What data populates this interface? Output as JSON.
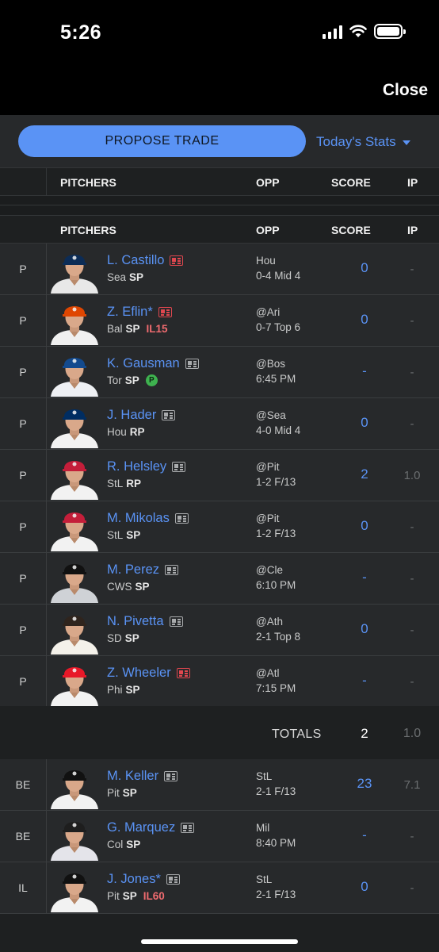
{
  "status_bar": {
    "time": "5:26"
  },
  "nav": {
    "close_label": "Close"
  },
  "actions": {
    "propose_trade_label": "PROPOSE TRADE",
    "stats_view_label": "Today's Stats"
  },
  "columns": {
    "pitchers": "PITCHERS",
    "opp": "OPP",
    "score": "SCORE",
    "ip": "IP"
  },
  "players": [
    {
      "pos": "P",
      "name": "L. Castillo",
      "news_hot": true,
      "team": "Sea",
      "slot": "SP",
      "injury": "",
      "badge": "",
      "opp": "Hou",
      "game": "0-4 Mid 4",
      "score": "0",
      "ip": "-",
      "cap_color": "#0c2c56",
      "jersey_color": "#e8e8e8"
    },
    {
      "pos": "P",
      "name": "Z. Eflin*",
      "news_hot": true,
      "team": "Bal",
      "slot": "SP",
      "injury": "IL15",
      "badge": "",
      "opp": "@Ari",
      "game": "0-7 Top 6",
      "score": "0",
      "ip": "-",
      "cap_color": "#df4601",
      "jersey_color": "#f0f0f0"
    },
    {
      "pos": "P",
      "name": "K. Gausman",
      "news_hot": false,
      "team": "Tor",
      "slot": "SP",
      "injury": "",
      "badge": "P",
      "opp": "@Bos",
      "game": "6:45 PM",
      "score": "-",
      "ip": "-",
      "cap_color": "#134a8e",
      "jersey_color": "#eef0f4"
    },
    {
      "pos": "P",
      "name": "J. Hader",
      "news_hot": false,
      "team": "Hou",
      "slot": "RP",
      "injury": "",
      "badge": "",
      "opp": "@Sea",
      "game": "4-0 Mid 4",
      "score": "0",
      "ip": "-",
      "cap_color": "#002d62",
      "jersey_color": "#f2f2f2"
    },
    {
      "pos": "P",
      "name": "R. Helsley",
      "news_hot": false,
      "team": "StL",
      "slot": "RP",
      "injury": "",
      "badge": "",
      "opp": "@Pit",
      "game": "1-2 F/13",
      "score": "2",
      "ip": "1.0",
      "cap_color": "#c41e3a",
      "jersey_color": "#f2f2f2"
    },
    {
      "pos": "P",
      "name": "M. Mikolas",
      "news_hot": false,
      "team": "StL",
      "slot": "SP",
      "injury": "",
      "badge": "",
      "opp": "@Pit",
      "game": "1-2 F/13",
      "score": "0",
      "ip": "-",
      "cap_color": "#c41e3a",
      "jersey_color": "#f2f2f2"
    },
    {
      "pos": "P",
      "name": "M. Perez",
      "news_hot": false,
      "team": "CWS",
      "slot": "SP",
      "injury": "",
      "badge": "",
      "opp": "@Cle",
      "game": "6:10 PM",
      "score": "-",
      "ip": "-",
      "cap_color": "#111111",
      "jersey_color": "#cfd2d6"
    },
    {
      "pos": "P",
      "name": "N. Pivetta",
      "news_hot": false,
      "team": "SD",
      "slot": "SP",
      "injury": "",
      "badge": "",
      "opp": "@Ath",
      "game": "2-1 Top 8",
      "score": "0",
      "ip": "-",
      "cap_color": "#2f241d",
      "jersey_color": "#f4f1ea"
    },
    {
      "pos": "P",
      "name": "Z. Wheeler",
      "news_hot": true,
      "team": "Phi",
      "slot": "SP",
      "injury": "",
      "badge": "",
      "opp": "@Atl",
      "game": "7:15 PM",
      "score": "-",
      "ip": "-",
      "cap_color": "#e81828",
      "jersey_color": "#f2f2f2"
    }
  ],
  "totals": {
    "label": "TOTALS",
    "score": "2",
    "ip": "1.0"
  },
  "bench": [
    {
      "pos": "BE",
      "name": "M. Keller",
      "news_hot": false,
      "team": "Pit",
      "slot": "SP",
      "injury": "",
      "badge": "",
      "opp": "StL",
      "game": "2-1 F/13",
      "score": "23",
      "ip": "7.1",
      "cap_color": "#111111",
      "jersey_color": "#f2f2f2"
    },
    {
      "pos": "BE",
      "name": "G. Marquez",
      "news_hot": false,
      "team": "Col",
      "slot": "SP",
      "injury": "",
      "badge": "",
      "opp": "Mil",
      "game": "8:40 PM",
      "score": "-",
      "ip": "-",
      "cap_color": "#1e1e1e",
      "jersey_color": "#e4e4ea"
    },
    {
      "pos": "IL",
      "name": "J. Jones*",
      "news_hot": false,
      "team": "Pit",
      "slot": "SP",
      "injury": "IL60",
      "badge": "",
      "opp": "StL",
      "game": "2-1 F/13",
      "score": "0",
      "ip": "-",
      "cap_color": "#111111",
      "jersey_color": "#f2f2f2"
    }
  ]
}
